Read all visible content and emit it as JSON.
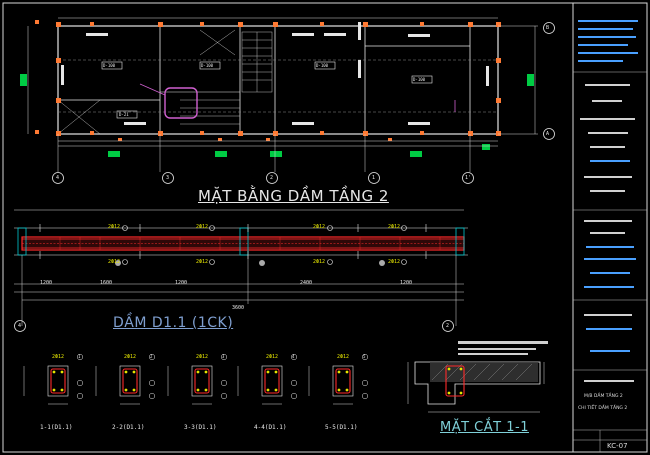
{
  "titles": {
    "plan": "MẶT BẰNG DẦM TẦNG 2",
    "beam": "DẦM D1.1 (1CK)",
    "section": "MẶT CẮT 1-1"
  },
  "grid_axes": {
    "top_right": "B",
    "bottom_right": "A",
    "plan_bottom": [
      "4",
      "3",
      "2",
      "1",
      "1'"
    ],
    "beam_left": "4",
    "beam_right": "2"
  },
  "room_tags": [
    "D-100",
    "D-100",
    "D-100",
    "D-100",
    "D-21"
  ],
  "section_labels": [
    "1-1(D1.1)",
    "2-2(D1.1)",
    "3-3(D1.1)",
    "4-4(D1.1)",
    "5-5(D1.1)"
  ],
  "section_cut_marks": [
    "1",
    "2",
    "3",
    "4",
    "5"
  ],
  "rebar_label": "2Ф12",
  "beam_dims": [
    "1200",
    "1600",
    "1200",
    "2400",
    "1200",
    "3600"
  ],
  "title_block": {
    "project": "M/B DẦM TẦNG 2",
    "subtitle": "CHI TIẾT DẦM TẦNG 2",
    "sheet": "KC-07"
  },
  "colors": {
    "background": "#000000",
    "wall": "#e6e6e6",
    "column": "#ff7a33",
    "window": "#00cc44",
    "beam_red": "#ff2a2a",
    "dimension": "#e6e600",
    "highlight": "#d060d0",
    "grid_cyan": "#00c8d0"
  }
}
